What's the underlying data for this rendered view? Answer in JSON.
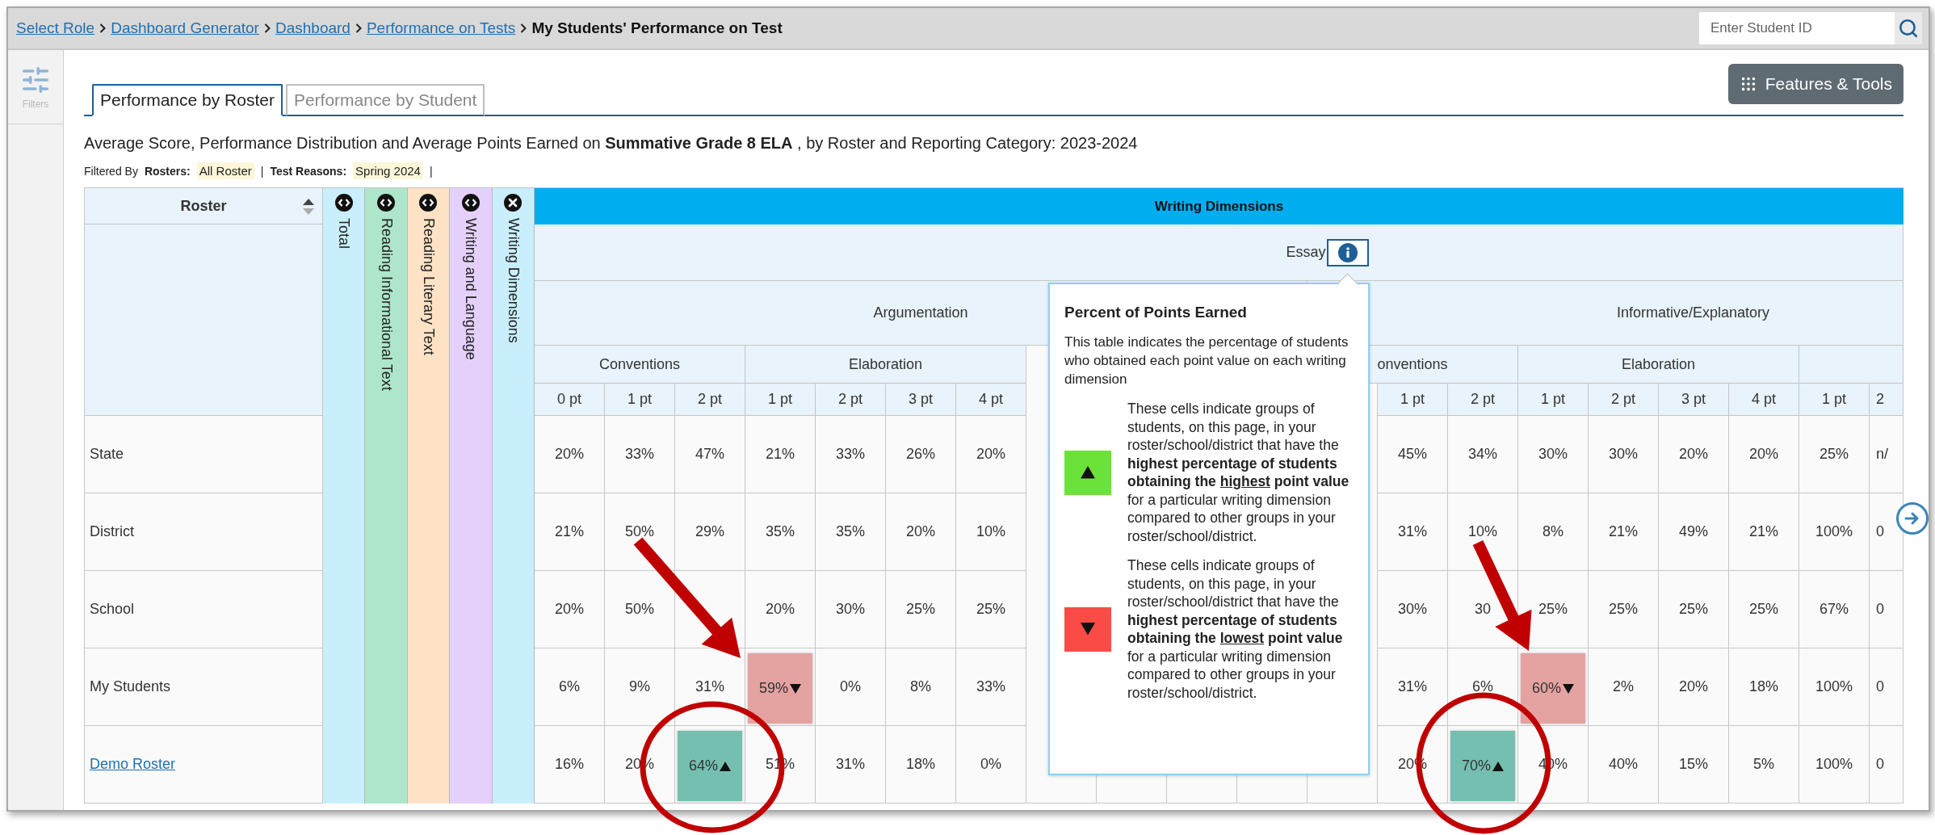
{
  "breadcrumb": [
    {
      "label": "Select Role",
      "current": false
    },
    {
      "label": "Dashboard Generator",
      "current": false
    },
    {
      "label": "Dashboard",
      "current": false
    },
    {
      "label": "Performance on Tests",
      "current": false
    },
    {
      "label": "My Students' Performance on Test",
      "current": true
    }
  ],
  "search": {
    "placeholder": "Enter Student ID"
  },
  "sidebar": {
    "filters_label": "Filters"
  },
  "tabs": [
    {
      "label": "Performance by Roster",
      "selected": true
    },
    {
      "label": "Performance by Student",
      "selected": false
    }
  ],
  "features_button": "Features & Tools",
  "report_title": "Average Score, Performance Distribution and Average Points Earned on **Summative Grade 8 ELA** , by Roster and Reporting Category: 2023-2024",
  "filters": {
    "label": "Filtered By",
    "items": [
      {
        "name": "Rosters:",
        "value": "All Roster",
        "separator": "|"
      },
      {
        "name": "Test Reasons:",
        "value": "Spring 2024",
        "separator": "|"
      }
    ]
  },
  "table": {
    "roster_header": "Roster",
    "category_columns": [
      {
        "label": "Total",
        "color": "#c9effc",
        "expanded": false
      },
      {
        "label": "Reading Informational Text",
        "color": "#aee6cb",
        "expanded": false
      },
      {
        "label": "Reading Literary Text",
        "color": "#fde2c5",
        "expanded": false
      },
      {
        "label": "Writing and Language",
        "color": "#e5d0fb",
        "expanded": false
      },
      {
        "label": "Writing Dimensions",
        "color": "#c9effc",
        "expanded": true
      }
    ],
    "band_title": "Writing Dimensions",
    "essay_label": "Essay",
    "groups": [
      {
        "label": "Argumentation",
        "subgroups": [
          {
            "label": "Conventions",
            "points": [
              "0 pt",
              "1 pt",
              "2 pt"
            ]
          },
          {
            "label": "Elaboration",
            "points": [
              "1 pt",
              "2 pt",
              "3 pt",
              "4 pt"
            ]
          }
        ]
      },
      {
        "label": "Informative/Explanatory",
        "subgroups": [
          {
            "label": "onventions",
            "points": [
              "1 pt",
              "2 pt"
            ]
          },
          {
            "label": "Elaboration",
            "points": [
              "1 pt",
              "2 pt",
              "3 pt",
              "4 pt"
            ]
          },
          {
            "points": [
              "1 pt",
              "2"
            ]
          }
        ]
      }
    ],
    "rows": [
      {
        "label": "State",
        "link": false,
        "cells": [
          [
            {
              "value": "20%",
              "kind": "plain"
            },
            {
              "value": "33%",
              "kind": "plain"
            },
            {
              "value": "47%",
              "kind": "plain"
            },
            {
              "value": "21%",
              "kind": "plain"
            },
            {
              "value": "33%",
              "kind": "plain"
            },
            {
              "value": "26%",
              "kind": "plain"
            },
            {
              "value": "20%",
              "kind": "plain"
            }
          ],
          [
            {
              "value": "45%",
              "kind": "plain"
            },
            {
              "value": "34%",
              "kind": "plain"
            },
            {
              "value": "30%",
              "kind": "plain"
            },
            {
              "value": "30%",
              "kind": "plain"
            },
            {
              "value": "20%",
              "kind": "plain"
            },
            {
              "value": "20%",
              "kind": "plain"
            },
            {
              "value": "25%",
              "kind": "plain"
            },
            {
              "value": "n/",
              "kind": "plain"
            }
          ]
        ]
      },
      {
        "label": "District",
        "link": false,
        "cells": [
          [
            {
              "value": "21%",
              "kind": "plain"
            },
            {
              "value": "50%",
              "kind": "plain"
            },
            {
              "value": "29%",
              "kind": "plain"
            },
            {
              "value": "35%",
              "kind": "plain"
            },
            {
              "value": "35%",
              "kind": "plain"
            },
            {
              "value": "20%",
              "kind": "plain"
            },
            {
              "value": "10%",
              "kind": "plain"
            }
          ],
          [
            {
              "value": "31%",
              "kind": "plain"
            },
            {
              "value": "10%",
              "kind": "plain"
            },
            {
              "value": "8%",
              "kind": "plain"
            },
            {
              "value": "21%",
              "kind": "plain"
            },
            {
              "value": "49%",
              "kind": "plain"
            },
            {
              "value": "21%",
              "kind": "plain"
            },
            {
              "value": "100%",
              "kind": "plain"
            },
            {
              "value": "0",
              "kind": "plain"
            }
          ]
        ]
      },
      {
        "label": "School",
        "link": false,
        "cells": [
          [
            {
              "value": "20%",
              "kind": "plain"
            },
            {
              "value": "50%",
              "kind": "plain"
            },
            null,
            {
              "value": "20%",
              "kind": "plain"
            },
            {
              "value": "30%",
              "kind": "plain"
            },
            {
              "value": "25%",
              "kind": "plain"
            },
            {
              "value": "25%",
              "kind": "plain"
            }
          ],
          [
            {
              "value": "30%",
              "kind": "plain"
            },
            {
              "value": "30",
              "kind": "plain"
            },
            {
              "value": "25%",
              "kind": "plain"
            },
            {
              "value": "25%",
              "kind": "plain"
            },
            {
              "value": "25%",
              "kind": "plain"
            },
            {
              "value": "25%",
              "kind": "plain"
            },
            {
              "value": "67%",
              "kind": "plain"
            },
            {
              "value": "0",
              "kind": "plain"
            }
          ]
        ]
      },
      {
        "label": "My Students",
        "link": false,
        "cells": [
          [
            {
              "value": "6%",
              "kind": "plain"
            },
            {
              "value": "9%",
              "kind": "plain"
            },
            {
              "value": "31%",
              "kind": "plain"
            },
            {
              "value": "59%",
              "kind": "down"
            },
            {
              "value": "0%",
              "kind": "plain"
            },
            {
              "value": "8%",
              "kind": "plain"
            },
            {
              "value": "33%",
              "kind": "plain"
            }
          ],
          [
            {
              "value": "31%",
              "kind": "plain"
            },
            {
              "value": "6%",
              "kind": "plain"
            },
            {
              "value": "60%",
              "kind": "down"
            },
            {
              "value": "2%",
              "kind": "plain"
            },
            {
              "value": "20%",
              "kind": "plain"
            },
            {
              "value": "18%",
              "kind": "plain"
            },
            {
              "value": "100%",
              "kind": "plain"
            },
            {
              "value": "0",
              "kind": "plain"
            }
          ]
        ]
      },
      {
        "label": "Demo Roster",
        "link": true,
        "cells": [
          [
            {
              "value": "16%",
              "kind": "plain"
            },
            {
              "value": "20%",
              "kind": "plain"
            },
            {
              "value": "64%",
              "kind": "up"
            },
            {
              "value": "51%",
              "kind": "plain"
            },
            {
              "value": "31%",
              "kind": "plain"
            },
            {
              "value": "18%",
              "kind": "plain"
            },
            {
              "value": "0%",
              "kind": "plain"
            }
          ],
          [
            {
              "value": "20%",
              "kind": "plain"
            },
            {
              "value": "70%",
              "kind": "up"
            },
            {
              "value": "40%",
              "kind": "plain"
            },
            {
              "value": "40%",
              "kind": "plain"
            },
            {
              "value": "15%",
              "kind": "plain"
            },
            {
              "value": "5%",
              "kind": "plain"
            },
            {
              "value": "100%",
              "kind": "plain"
            },
            {
              "value": "0",
              "kind": "plain"
            }
          ]
        ]
      }
    ]
  },
  "info_popover": {
    "title": "Percent of Points Earned",
    "intro": "This table indicates the percentage of students who obtained each point value on each writing dimension",
    "legend": [
      {
        "kind": "up",
        "color": "#6be23a",
        "parts": [
          {
            "text": "These cells indicate groups of students, on this page, in your roster/school/district that have the ",
            "bold": false,
            "underline": false
          },
          {
            "text": "highest percentage of students obtaining the ",
            "bold": true,
            "underline": false
          },
          {
            "text": "highest",
            "bold": true,
            "underline": true
          },
          {
            "text": " point value",
            "bold": true,
            "underline": false
          },
          {
            "text": " for a particular writing dimension compared to other groups in your roster/school/district.",
            "bold": false,
            "underline": false
          }
        ]
      },
      {
        "kind": "down",
        "color": "#fa4b47",
        "parts": [
          {
            "text": "These cells indicate groups of students, on this page, in your roster/school/district that have the ",
            "bold": false,
            "underline": false
          },
          {
            "text": "highest percentage of students obtaining the ",
            "bold": true,
            "underline": false
          },
          {
            "text": "lowest",
            "bold": true,
            "underline": true
          },
          {
            "text": " point value",
            "bold": true,
            "underline": false
          },
          {
            "text": " for a particular writing dimension compared to other groups in your roster/school/district.",
            "bold": false,
            "underline": false
          }
        ]
      }
    ]
  }
}
